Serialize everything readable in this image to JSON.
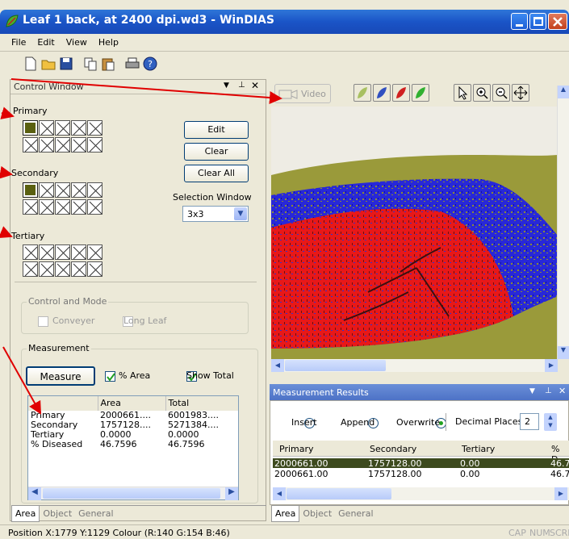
{
  "window": {
    "title": "Leaf 1 back, at 2400 dpi.wd3 - WinDIAS"
  },
  "menu": [
    "File",
    "Edit",
    "View",
    "Help"
  ],
  "control": {
    "title": "Control Window",
    "primary_label": "Primary",
    "secondary_label": "Secondary",
    "tertiary_label": "Tertiary",
    "edit": "Edit",
    "clear": "Clear",
    "clear_all": "Clear All",
    "selection_window_label": "Selection Window",
    "selection_window_value": "3x3",
    "control_mode_label": "Control and Mode",
    "conveyer": "Conveyer",
    "long_leaf": "Long Leaf",
    "measurement_label": "Measurement",
    "measure": "Measure",
    "pct_area": "% Area",
    "show_total": "Show Total"
  },
  "results_left": {
    "headers": [
      "",
      "Area",
      "Total"
    ],
    "rows": [
      [
        "Primary",
        "2000661....",
        "6001983...."
      ],
      [
        "Secondary",
        "1757128....",
        "5271384...."
      ],
      [
        "Tertiary",
        "0.0000",
        "0.0000"
      ],
      [
        "% Diseased",
        "46.7596",
        "46.7596"
      ]
    ]
  },
  "left_tabs": [
    "Area",
    "Object",
    "General"
  ],
  "video": {
    "label": "Video"
  },
  "measurement_results": {
    "title": "Measurement Results",
    "insert": "Insert",
    "append": "Append",
    "overwrite": "Overwrite",
    "decimal_places_label": "Decimal Places",
    "decimal_places_value": "2",
    "headers": [
      "Primary",
      "Secondary",
      "Tertiary",
      "% D"
    ],
    "rows": [
      [
        "2000661.00",
        "1757128.00",
        "0.00",
        "46.7"
      ],
      [
        "2000661.00",
        "1757128.00",
        "0.00",
        "46.7"
      ]
    ]
  },
  "right_tabs": [
    "Area",
    "Object",
    "General"
  ],
  "status": {
    "text": "Position  X:1779 Y:1129  Colour (R:140 G:154 B:46)",
    "cap": "CAP",
    "num": "NUM",
    "scrl": "SCRL"
  },
  "colors": {
    "title_blue": "#1a54c7",
    "primary_swatch": "#5a6010",
    "annotation": "#e00000",
    "leaf_olive": "#9a9a3a",
    "disease_red": "#e81010",
    "disease_blue": "#2020e0"
  }
}
